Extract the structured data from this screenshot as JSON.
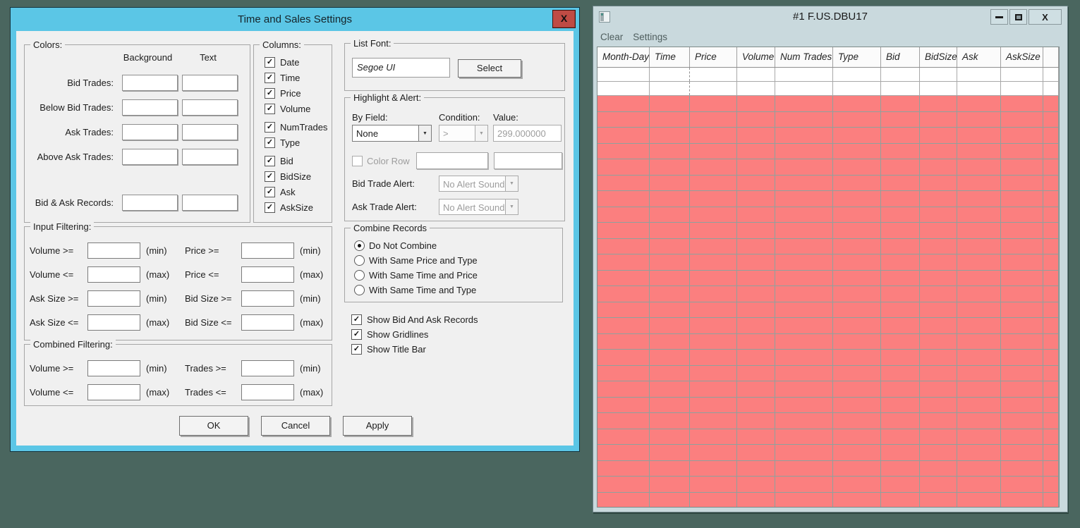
{
  "icons": {
    "checkmark": "✓",
    "dropdown_arrow": "▼",
    "close_x": "X"
  },
  "settings_dialog": {
    "title": "Time and Sales Settings",
    "titlebar_color": "#5bc6e6",
    "close_button_color": "#bf4b44",
    "colors": {
      "title": "Colors:",
      "background_header": "Background",
      "text_header": "Text",
      "rows": [
        {
          "label": "Bid Trades:"
        },
        {
          "label": "Below Bid Trades:"
        },
        {
          "label": "Ask Trades:"
        },
        {
          "label": "Above Ask Trades:"
        },
        {
          "label": "Bid & Ask Records:"
        }
      ]
    },
    "columns": {
      "title": "Columns:",
      "items": [
        {
          "label": "Date",
          "checked": true
        },
        {
          "label": "Time",
          "checked": true
        },
        {
          "label": "Price",
          "checked": true
        },
        {
          "label": "Volume",
          "checked": true
        },
        {
          "label": "NumTrades",
          "checked": true
        },
        {
          "label": "Type",
          "checked": true
        },
        {
          "label": "Bid",
          "checked": true
        },
        {
          "label": "BidSize",
          "checked": true
        },
        {
          "label": "Ask",
          "checked": true
        },
        {
          "label": "AskSize",
          "checked": true
        }
      ]
    },
    "list_font": {
      "title": "List Font:",
      "font_name": "Segoe UI",
      "select_button": "Select"
    },
    "highlight": {
      "title": "Highlight & Alert:",
      "by_field_label": "By Field:",
      "by_field_value": "None",
      "condition_label": "Condition:",
      "condition_value": ">",
      "condition_enabled": false,
      "value_label": "Value:",
      "value_text": "299.000000",
      "value_enabled": false,
      "color_row_label": "Color Row",
      "color_row_checked": false,
      "color_row_enabled": false,
      "bid_alert_label": "Bid Trade Alert:",
      "bid_alert_value": "No Alert Sound",
      "bid_alert_enabled": false,
      "ask_alert_label": "Ask Trade Alert:",
      "ask_alert_value": "No Alert Sound",
      "ask_alert_enabled": false
    },
    "input_filtering": {
      "title": "Input Filtering:",
      "rows": [
        {
          "l": "Volume >=",
          "lh": "(min)",
          "r": "Price >=",
          "rh": "(min)"
        },
        {
          "l": "Volume <=",
          "lh": "(max)",
          "r": "Price <=",
          "rh": "(max)"
        },
        {
          "l": "Ask Size >=",
          "lh": "(min)",
          "r": "Bid Size >=",
          "rh": "(min)"
        },
        {
          "l": "Ask Size <=",
          "lh": "(max)",
          "r": "Bid Size <=",
          "rh": "(max)"
        }
      ]
    },
    "combine_records": {
      "title": "Combine Records",
      "options": [
        {
          "label": "Do Not Combine",
          "selected": true
        },
        {
          "label": "With Same Price and Type",
          "selected": false
        },
        {
          "label": "With Same Time and Price",
          "selected": false
        },
        {
          "label": "With Same Time and Type",
          "selected": false
        }
      ]
    },
    "display_options": [
      {
        "label": "Show Bid And Ask Records",
        "checked": true
      },
      {
        "label": "Show Gridlines",
        "checked": true
      },
      {
        "label": "Show Title Bar",
        "checked": true
      }
    ],
    "combined_filtering": {
      "title": "Combined Filtering:",
      "rows": [
        {
          "l": "Volume >=",
          "lh": "(min)",
          "r": "Trades >=",
          "rh": "(min)"
        },
        {
          "l": "Volume <=",
          "lh": "(max)",
          "r": "Trades <=",
          "rh": "(max)"
        }
      ]
    },
    "action_buttons": {
      "ok": "OK",
      "cancel": "Cancel",
      "apply": "Apply"
    }
  },
  "quote_window": {
    "title": "#1 F.US.DBU17",
    "menu_items": [
      "Clear",
      "Settings"
    ],
    "columns": [
      "Month-Day",
      "Time",
      "Price",
      "Volume",
      "Num Trades",
      "Type",
      "Bid",
      "BidSize",
      "Ask",
      "AskSize"
    ],
    "empty_white_row_count": 2,
    "highlighted_row_count": 26,
    "colors": {
      "row_highlight": "#fb7f7f",
      "grid_highlight_area": "#8fa19d",
      "frame": "#c9d9dd",
      "desktop": "#4a665f"
    }
  }
}
